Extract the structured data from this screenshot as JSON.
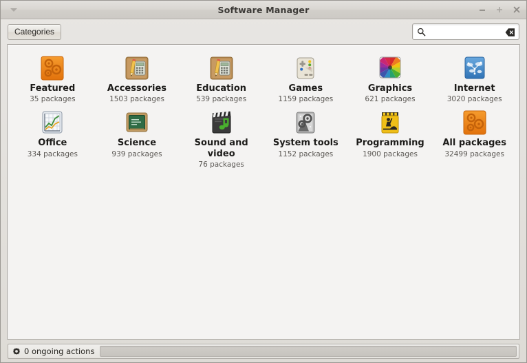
{
  "window": {
    "title": "Software Manager",
    "menu_icon": "chevron-down-icon",
    "controls": {
      "minimize": "−",
      "maximize": "+",
      "close": "×"
    }
  },
  "toolbar": {
    "categories_label": "Categories",
    "search": {
      "icon": "search-icon",
      "value": "",
      "placeholder": "",
      "clear_icon": "clear-text-icon"
    }
  },
  "categories": [
    {
      "label": "Featured",
      "count": "35 packages",
      "icon": "gears-orange-icon"
    },
    {
      "label": "Accessories",
      "count": "1503 packages",
      "icon": "calculator-pencil-icon"
    },
    {
      "label": "Education",
      "count": "539 packages",
      "icon": "calculator-pencil-icon"
    },
    {
      "label": "Games",
      "count": "1159 packages",
      "icon": "gamepad-icon"
    },
    {
      "label": "Graphics",
      "count": "621 packages",
      "icon": "color-wheel-icon"
    },
    {
      "label": "Internet",
      "count": "3020 packages",
      "icon": "globe-network-icon"
    },
    {
      "label": "Office",
      "count": "334 packages",
      "icon": "chart-graph-icon"
    },
    {
      "label": "Science",
      "count": "939 packages",
      "icon": "chalkboard-icon"
    },
    {
      "label": "Sound and video",
      "count": "76 packages",
      "icon": "clapperboard-music-icon"
    },
    {
      "label": "System tools",
      "count": "1152 packages",
      "icon": "system-gears-icon"
    },
    {
      "label": "Programming",
      "count": "1900 packages",
      "icon": "construction-sign-icon"
    },
    {
      "label": "All packages",
      "count": "32499 packages",
      "icon": "gears-orange-icon"
    }
  ],
  "statusbar": {
    "icon": "gear-icon",
    "text": "0 ongoing actions",
    "progress_percent": 0
  },
  "colors": {
    "window_bg": "#dedbd6",
    "panel_bg": "#f4f3f2",
    "title_text": "#3b3936",
    "accent_orange": "#f08b1d",
    "accent_blue": "#4d93d0"
  }
}
